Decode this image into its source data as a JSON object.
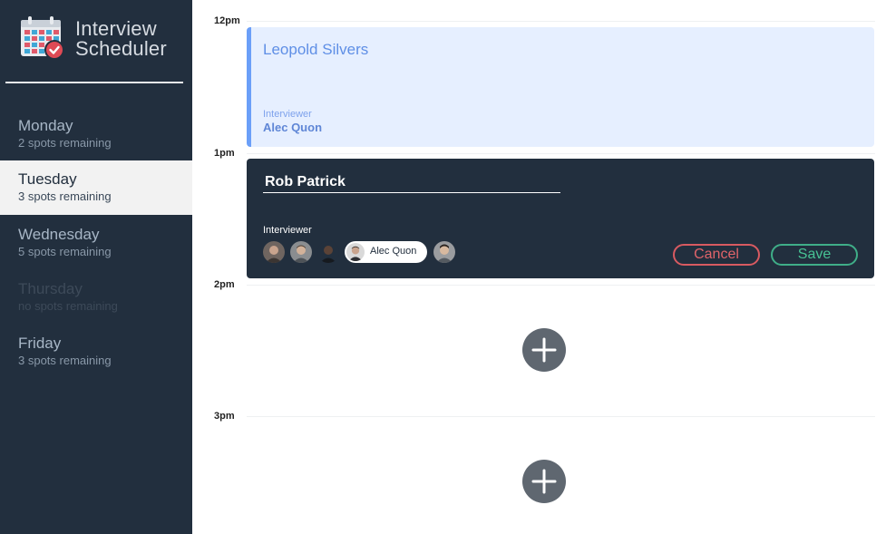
{
  "app": {
    "title_line1": "Interview",
    "title_line2": "Scheduler",
    "logo_icon": "calendar-check-icon"
  },
  "days": [
    {
      "name": "Monday",
      "spots": "2 spots remaining",
      "state": "normal"
    },
    {
      "name": "Tuesday",
      "spots": "3 spots remaining",
      "state": "selected"
    },
    {
      "name": "Wednesday",
      "spots": "5 spots remaining",
      "state": "normal"
    },
    {
      "name": "Thursday",
      "spots": "no spots remaining",
      "state": "full"
    },
    {
      "name": "Friday",
      "spots": "3 spots remaining",
      "state": "normal"
    }
  ],
  "times": [
    "12pm",
    "1pm",
    "2pm",
    "3pm"
  ],
  "appointments": [
    {
      "mode": "show",
      "student": "Leopold Silvers",
      "interviewer_label": "Interviewer",
      "interviewer": "Alec Quon"
    },
    {
      "mode": "edit",
      "student": "Rob Patrick",
      "interviewer_label": "Interviewer",
      "selected_interviewer": "Alec Quon",
      "cancel_label": "Cancel",
      "save_label": "Save"
    }
  ],
  "add_icon": "plus-icon",
  "colors": {
    "sidebar": "#222f3e",
    "accent_blue": "#6b9ff8",
    "cancel": "#e0646a",
    "save": "#47c294"
  }
}
